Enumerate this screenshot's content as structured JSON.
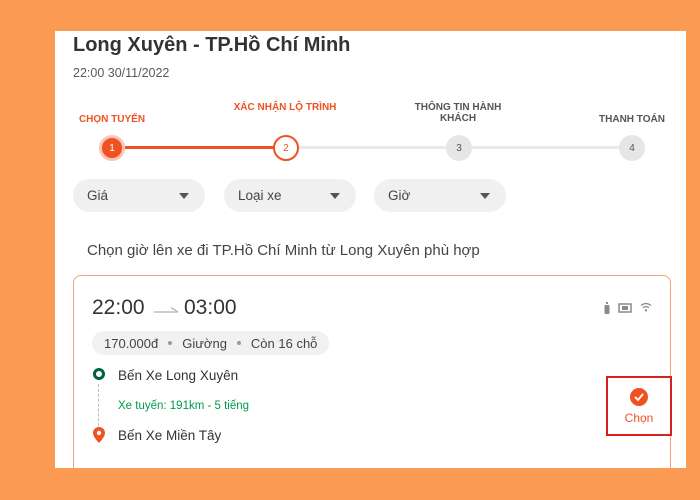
{
  "header": {
    "title": "Long Xuyên - TP.Hồ Chí Minh",
    "datetime": "22:00 30/11/2022"
  },
  "stepper": {
    "steps": [
      {
        "label": "CHỌN TUYẾN",
        "number": "1",
        "state": "done"
      },
      {
        "label": "XÁC NHẬN LỘ TRÌNH",
        "number": "2",
        "state": "current"
      },
      {
        "label": "THÔNG TIN HÀNH KHÁCH",
        "number": "3",
        "state": "todo"
      },
      {
        "label": "THANH TOÁN",
        "number": "4",
        "state": "todo"
      }
    ]
  },
  "filters": [
    {
      "label": "Giá"
    },
    {
      "label": "Loại xe"
    },
    {
      "label": "Giờ"
    }
  ],
  "section_heading": "Chọn giờ lên xe đi TP.Hồ Chí Minh từ Long Xuyên phù hợp",
  "trip": {
    "departure_time": "22:00",
    "arrival_time": "03:00",
    "price": "170.000đ",
    "seat_type": "Giường",
    "seats_left": "Còn 16 chỗ",
    "origin": "Bến Xe Long Xuyên",
    "route_info": "Xe tuyến: 191km - 5 tiếng",
    "destination": "Bến Xe Miền Tây",
    "choose_label": "Chọn",
    "amenity_icons": [
      "water-bottle-icon",
      "blanket-icon",
      "wifi-icon"
    ]
  },
  "colors": {
    "background": "#fb9a52",
    "accent": "#ef5222",
    "origin_green": "#006241",
    "route_green": "#009a4a",
    "highlight_border": "#d62020"
  }
}
